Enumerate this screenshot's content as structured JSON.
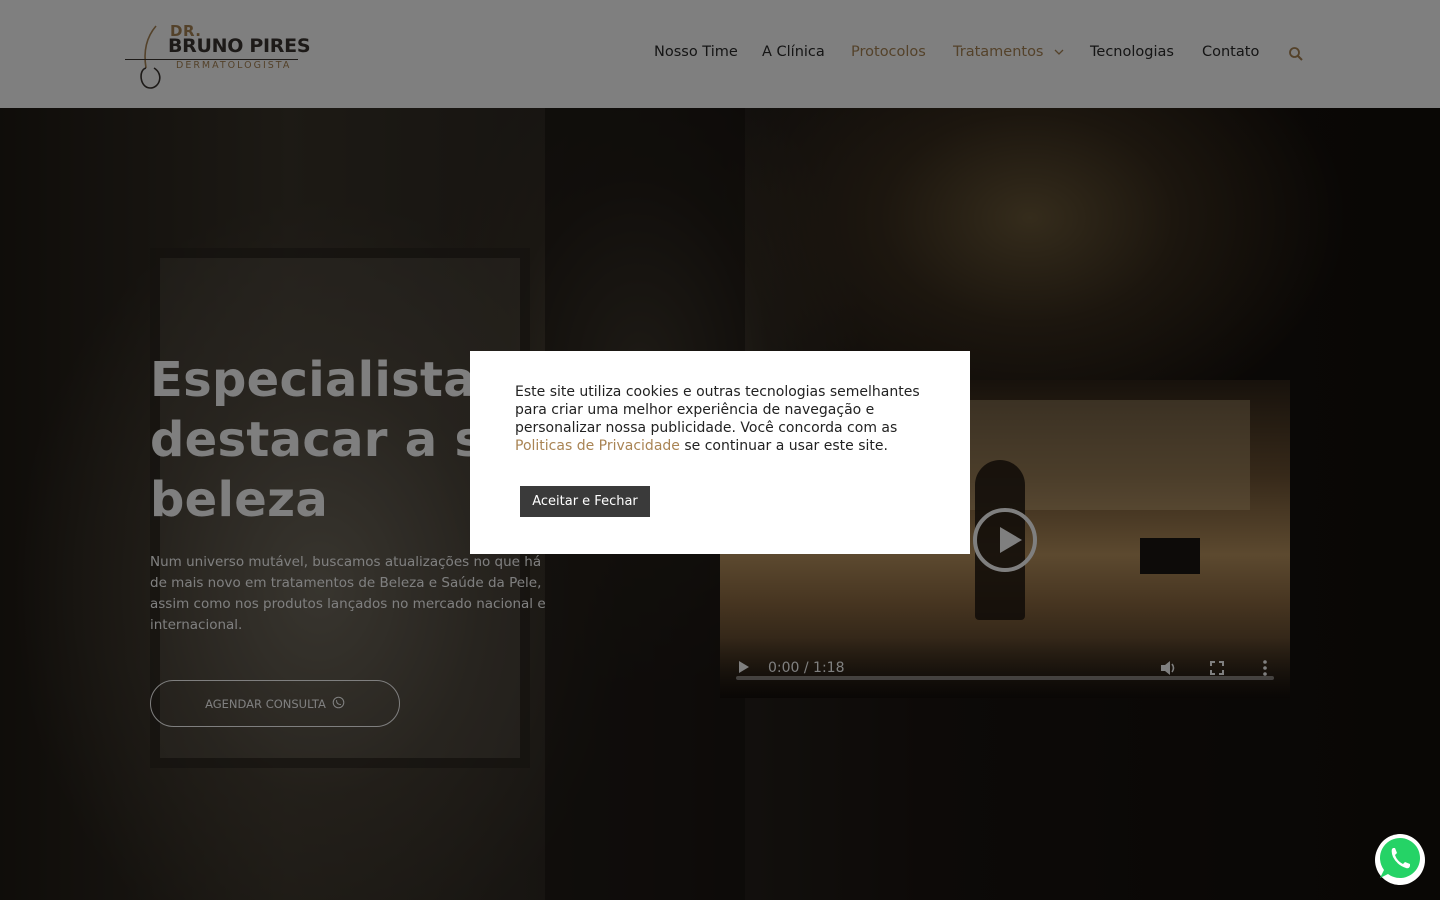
{
  "header": {
    "logo": {
      "prefix": "DR.",
      "name": "BRUNO PIRES",
      "subtitle": "DERMATOLOGISTA"
    },
    "nav": [
      {
        "label": "Nosso Time",
        "active": false
      },
      {
        "label": "A Clínica",
        "active": false
      },
      {
        "label": "Protocolos",
        "active": true
      },
      {
        "label": "Tratamentos",
        "active": true,
        "has_dropdown": true
      },
      {
        "label": "Tecnologias",
        "active": false
      },
      {
        "label": "Contato",
        "active": false
      }
    ],
    "search_icon": "search-icon"
  },
  "hero": {
    "title_lines": [
      "Especialistas em",
      "destacar a sua",
      "beleza"
    ],
    "description": "Num universo mutável, buscamos atualizações no que há de mais novo em tratamentos de Beleza e Saúde da Pele, assim como nos produtos lançados no mercado nacional e internacional.",
    "cta_label": "AGENDAR CONSULTA",
    "cta_icon": "whatsapp-icon"
  },
  "video": {
    "time": "0:00 / 1:18",
    "progress": 0,
    "icons": [
      "play-icon",
      "volume-icon",
      "fullscreen-icon",
      "more-options-icon"
    ]
  },
  "cookie_modal": {
    "text_before": "Este site utiliza cookies e outras tecnologias semelhantes para criar uma melhor experiência de navegação e personalizar nossa publicidade. Você concorda com as ",
    "link_text": "Politicas de Privacidade",
    "text_after": " se continuar a usar este site.",
    "accept_label": "Aceitar e Fechar"
  },
  "colors": {
    "accent": "#a98454",
    "overlay": "rgba(0,0,0,0.5)",
    "button_dark": "#3a3a3a",
    "whatsapp": "#25d366"
  }
}
